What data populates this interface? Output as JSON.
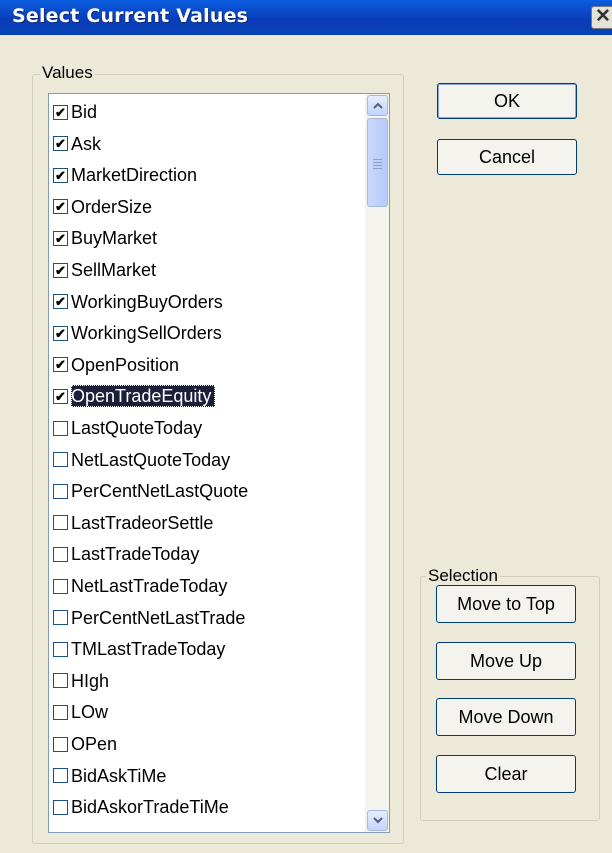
{
  "window": {
    "title": "Select Current Values",
    "close_glyph": "✕"
  },
  "values_group": {
    "label": "Values"
  },
  "selection_group": {
    "label": "Selection"
  },
  "buttons": {
    "ok": "OK",
    "cancel": "Cancel",
    "move_to_top": "Move to Top",
    "move_up": "Move Up",
    "move_down": "Move Down",
    "clear": "Clear"
  },
  "list": {
    "selected_index": 9,
    "items": [
      {
        "label": "Bid",
        "checked": true
      },
      {
        "label": "Ask",
        "checked": true
      },
      {
        "label": "MarketDirection",
        "checked": true
      },
      {
        "label": "OrderSize",
        "checked": true
      },
      {
        "label": "BuyMarket",
        "checked": true
      },
      {
        "label": "SellMarket",
        "checked": true
      },
      {
        "label": "WorkingBuyOrders",
        "checked": true
      },
      {
        "label": "WorkingSellOrders",
        "checked": true
      },
      {
        "label": "OpenPosition",
        "checked": true
      },
      {
        "label": "OpenTradeEquity",
        "checked": true
      },
      {
        "label": "LastQuoteToday",
        "checked": false
      },
      {
        "label": "NetLastQuoteToday",
        "checked": false
      },
      {
        "label": "PerCentNetLastQuote",
        "checked": false
      },
      {
        "label": "LastTradeorSettle",
        "checked": false
      },
      {
        "label": "LastTradeToday",
        "checked": false
      },
      {
        "label": "NetLastTradeToday",
        "checked": false
      },
      {
        "label": "PerCentNetLastTrade",
        "checked": false
      },
      {
        "label": "TMLastTradeToday",
        "checked": false
      },
      {
        "label": "HIgh",
        "checked": false
      },
      {
        "label": "LOw",
        "checked": false
      },
      {
        "label": "OPen",
        "checked": false
      },
      {
        "label": "BidAskTiMe",
        "checked": false
      },
      {
        "label": "BidAskorTradeTiMe",
        "checked": false
      }
    ]
  },
  "scrollbar": {
    "up_icon": "chevron-up-icon",
    "down_icon": "chevron-down-icon",
    "position": 0
  }
}
